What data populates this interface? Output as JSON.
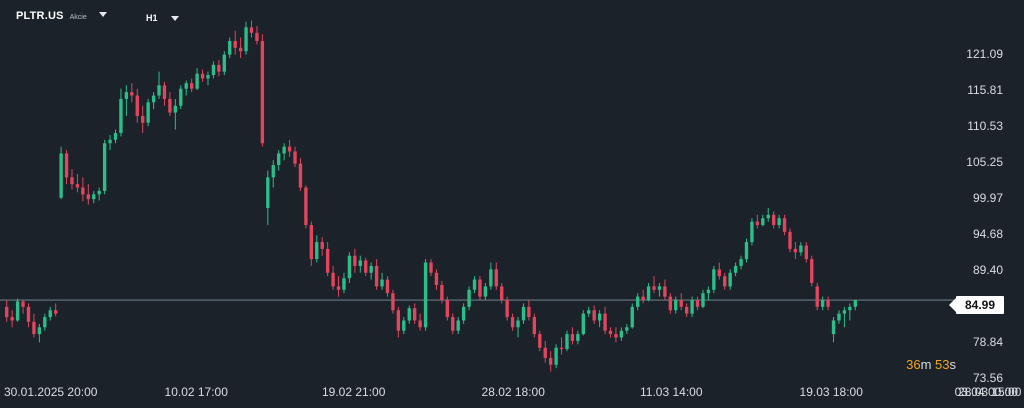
{
  "header": {
    "symbol": "PLTR.US",
    "symbol_type": "Akcie",
    "timeframe": "H1"
  },
  "countdown": {
    "minutes": "36",
    "m": "m",
    "seconds": "53",
    "s": "s"
  },
  "colors": {
    "background": "#1b2229",
    "up": "#2dbd8a",
    "down": "#e2455e",
    "axis_text": "#d9dde1",
    "price_line": "#8aa0ad",
    "countdown": "#f2a51f"
  },
  "chart_data": {
    "type": "candlestick",
    "symbol": "PLTR.US",
    "timeframe": "H1",
    "y_ticks": [
      121.09,
      115.81,
      110.53,
      105.25,
      99.97,
      94.68,
      89.4,
      84.12,
      78.84,
      73.56
    ],
    "y_tick_labels": [
      "121.09",
      "115.81",
      "110.53",
      "105.25",
      "99.97",
      "94.68",
      "89.40",
      "84.12",
      "78.84",
      "73.56"
    ],
    "ylim": [
      73.56,
      126.0
    ],
    "x_tick_labels": [
      "30.01.2025  20:00",
      "10.02  17:00",
      "19.02  21:00",
      "28.02  18:00",
      "11.03  14:00",
      "19.03  18:00",
      "28.03  15:00",
      "03.04  00:00"
    ],
    "x_tick_positions": [
      0,
      0.158,
      0.313,
      0.47,
      0.626,
      0.783,
      0.939,
      1.0
    ],
    "current_price": 84.99,
    "current_price_label": "84.99",
    "grid": false,
    "candles": [
      [
        84.0,
        85.0,
        81.8,
        82.5
      ],
      [
        82.5,
        83.5,
        81.0,
        82.0
      ],
      [
        82.0,
        85.2,
        81.8,
        84.8
      ],
      [
        84.8,
        85.0,
        83.0,
        84.0
      ],
      [
        84.0,
        84.5,
        81.0,
        81.8
      ],
      [
        81.8,
        83.0,
        79.5,
        80.0
      ],
      [
        80.0,
        81.5,
        78.8,
        81.0
      ],
      [
        81.0,
        83.0,
        80.5,
        82.5
      ],
      [
        82.5,
        84.0,
        82.0,
        83.5
      ],
      [
        83.5,
        84.5,
        82.6,
        83.0
      ],
      [
        100.0,
        107.5,
        99.8,
        106.5
      ],
      [
        106.5,
        107.0,
        102.0,
        103.0
      ],
      [
        103.0,
        104.2,
        101.2,
        102.0
      ],
      [
        102.0,
        103.5,
        100.8,
        101.5
      ],
      [
        101.5,
        103.0,
        99.5,
        100.5
      ],
      [
        100.5,
        102.0,
        99.0,
        99.8
      ],
      [
        99.8,
        101.0,
        99.2,
        100.5
      ],
      [
        100.5,
        101.5,
        99.6,
        101.0
      ],
      [
        101.0,
        108.5,
        100.5,
        108.0
      ],
      [
        108.0,
        109.2,
        107.0,
        108.5
      ],
      [
        108.5,
        110.0,
        108.0,
        109.5
      ],
      [
        109.5,
        116.0,
        109.0,
        114.5
      ],
      [
        114.5,
        116.5,
        112.0,
        115.5
      ],
      [
        115.5,
        116.8,
        114.0,
        115.0
      ],
      [
        115.0,
        116.0,
        111.0,
        112.0
      ],
      [
        112.0,
        113.5,
        109.5,
        111.0
      ],
      [
        111.0,
        114.5,
        110.5,
        114.0
      ],
      [
        114.0,
        115.5,
        113.0,
        115.0
      ],
      [
        115.0,
        118.5,
        114.5,
        116.5
      ],
      [
        116.5,
        117.0,
        113.5,
        114.5
      ],
      [
        114.5,
        115.5,
        112.0,
        112.5
      ],
      [
        112.5,
        114.5,
        110.0,
        113.5
      ],
      [
        113.5,
        116.5,
        113.0,
        116.0
      ],
      [
        116.0,
        117.2,
        115.0,
        116.8
      ],
      [
        116.8,
        117.5,
        115.5,
        116.0
      ],
      [
        116.0,
        119.0,
        115.8,
        118.2
      ],
      [
        118.2,
        118.8,
        117.0,
        117.5
      ],
      [
        117.5,
        118.5,
        116.5,
        118.0
      ],
      [
        118.0,
        120.0,
        117.5,
        119.5
      ],
      [
        119.5,
        120.2,
        117.8,
        118.5
      ],
      [
        118.5,
        121.5,
        118.0,
        121.0
      ],
      [
        121.0,
        123.5,
        120.5,
        123.0
      ],
      [
        123.0,
        124.5,
        121.0,
        122.0
      ],
      [
        122.0,
        123.5,
        120.5,
        121.5
      ],
      [
        121.5,
        125.8,
        121.0,
        125.0
      ],
      [
        125.0,
        126.0,
        123.5,
        124.2
      ],
      [
        124.2,
        125.2,
        122.5,
        123.0
      ],
      [
        123.0,
        124.0,
        107.5,
        108.0
      ],
      [
        98.5,
        104.0,
        96.0,
        103.0
      ],
      [
        103.0,
        105.5,
        101.5,
        104.8
      ],
      [
        104.8,
        107.0,
        104.0,
        106.5
      ],
      [
        106.5,
        108.0,
        105.5,
        107.5
      ],
      [
        107.5,
        108.5,
        106.0,
        106.8
      ],
      [
        106.8,
        107.5,
        104.5,
        105.0
      ],
      [
        105.0,
        105.8,
        101.0,
        101.5
      ],
      [
        101.5,
        101.8,
        95.5,
        96.0
      ],
      [
        96.0,
        96.5,
        90.0,
        91.0
      ],
      [
        91.0,
        94.5,
        90.5,
        93.5
      ],
      [
        93.5,
        94.2,
        91.5,
        92.5
      ],
      [
        92.5,
        93.5,
        88.5,
        89.0
      ],
      [
        89.0,
        90.0,
        86.5,
        87.0
      ],
      [
        87.0,
        88.5,
        85.5,
        86.5
      ],
      [
        86.5,
        89.0,
        86.0,
        88.2
      ],
      [
        88.2,
        92.0,
        87.5,
        91.5
      ],
      [
        91.5,
        92.5,
        89.0,
        90.0
      ],
      [
        90.0,
        91.5,
        89.0,
        90.8
      ],
      [
        90.8,
        91.2,
        88.5,
        89.0
      ],
      [
        89.0,
        90.5,
        88.0,
        90.0
      ],
      [
        90.0,
        91.0,
        86.5,
        87.0
      ],
      [
        87.0,
        89.0,
        86.5,
        88.0
      ],
      [
        88.0,
        88.5,
        85.5,
        86.0
      ],
      [
        86.0,
        86.5,
        83.0,
        83.5
      ],
      [
        83.5,
        84.0,
        79.5,
        80.5
      ],
      [
        80.5,
        82.5,
        80.0,
        82.0
      ],
      [
        82.0,
        84.2,
        81.5,
        83.8
      ],
      [
        83.8,
        84.5,
        81.5,
        82.0
      ],
      [
        82.0,
        83.0,
        80.5,
        81.0
      ],
      [
        81.0,
        91.0,
        80.5,
        90.5
      ],
      [
        90.5,
        91.0,
        88.5,
        89.0
      ],
      [
        89.0,
        89.5,
        86.5,
        87.2
      ],
      [
        87.2,
        87.8,
        84.5,
        85.0
      ],
      [
        85.0,
        85.5,
        82.0,
        82.5
      ],
      [
        82.5,
        83.0,
        80.0,
        80.5
      ],
      [
        80.5,
        82.5,
        80.0,
        82.0
      ],
      [
        82.0,
        84.5,
        81.5,
        84.0
      ],
      [
        84.0,
        87.0,
        83.5,
        86.5
      ],
      [
        86.5,
        88.5,
        86.0,
        88.0
      ],
      [
        88.0,
        88.5,
        85.0,
        85.5
      ],
      [
        85.5,
        87.5,
        85.0,
        87.0
      ],
      [
        87.0,
        90.5,
        86.5,
        89.5
      ],
      [
        89.5,
        90.5,
        86.5,
        87.0
      ],
      [
        87.0,
        87.5,
        84.5,
        85.0
      ],
      [
        85.0,
        85.5,
        82.0,
        82.5
      ],
      [
        82.5,
        83.0,
        80.5,
        81.0
      ],
      [
        81.0,
        82.5,
        79.5,
        82.0
      ],
      [
        82.0,
        84.5,
        81.5,
        84.0
      ],
      [
        84.0,
        85.0,
        82.0,
        82.5
      ],
      [
        82.5,
        83.0,
        79.5,
        80.0
      ],
      [
        80.0,
        80.5,
        77.5,
        78.0
      ],
      [
        78.0,
        79.0,
        75.8,
        76.5
      ],
      [
        76.5,
        77.5,
        74.5,
        75.5
      ],
      [
        75.5,
        78.5,
        75.0,
        78.0
      ],
      [
        78.0,
        79.5,
        77.0,
        77.8
      ],
      [
        77.8,
        80.5,
        77.5,
        80.0
      ],
      [
        80.0,
        81.0,
        78.5,
        79.0
      ],
      [
        79.0,
        80.5,
        78.5,
        80.0
      ],
      [
        80.0,
        83.5,
        79.8,
        83.0
      ],
      [
        83.0,
        84.0,
        82.5,
        83.5
      ],
      [
        83.5,
        84.2,
        81.5,
        82.0
      ],
      [
        82.0,
        83.5,
        81.0,
        83.0
      ],
      [
        83.0,
        84.0,
        80.0,
        80.5
      ],
      [
        80.5,
        81.0,
        79.5,
        80.0
      ],
      [
        80.0,
        81.0,
        78.8,
        79.5
      ],
      [
        79.5,
        81.0,
        79.0,
        80.5
      ],
      [
        80.5,
        81.5,
        80.0,
        81.0
      ],
      [
        81.0,
        84.5,
        80.8,
        84.0
      ],
      [
        84.0,
        86.0,
        83.5,
        85.5
      ],
      [
        85.5,
        86.5,
        84.5,
        85.0
      ],
      [
        85.0,
        87.5,
        84.8,
        87.0
      ],
      [
        87.0,
        88.5,
        86.0,
        86.5
      ],
      [
        86.5,
        87.5,
        85.5,
        87.0
      ],
      [
        87.0,
        88.0,
        85.0,
        85.5
      ],
      [
        85.5,
        86.0,
        83.0,
        83.5
      ],
      [
        83.5,
        85.5,
        83.0,
        85.0
      ],
      [
        85.0,
        86.0,
        83.5,
        84.0
      ],
      [
        84.0,
        84.5,
        82.5,
        83.0
      ],
      [
        83.0,
        85.5,
        82.5,
        85.0
      ],
      [
        85.0,
        85.5,
        83.5,
        84.0
      ],
      [
        84.0,
        86.5,
        83.8,
        86.0
      ],
      [
        86.0,
        87.0,
        85.0,
        86.5
      ],
      [
        86.5,
        90.0,
        86.0,
        89.5
      ],
      [
        89.5,
        90.5,
        88.0,
        88.5
      ],
      [
        88.5,
        89.0,
        86.5,
        87.0
      ],
      [
        87.0,
        89.5,
        86.5,
        89.0
      ],
      [
        89.0,
        90.5,
        88.5,
        90.0
      ],
      [
        90.0,
        91.5,
        89.5,
        91.0
      ],
      [
        91.0,
        94.0,
        90.5,
        93.5
      ],
      [
        93.5,
        97.0,
        93.0,
        96.5
      ],
      [
        96.5,
        97.5,
        95.5,
        96.0
      ],
      [
        96.0,
        97.5,
        95.8,
        97.0
      ],
      [
        97.0,
        98.5,
        96.5,
        97.5
      ],
      [
        97.5,
        98.0,
        95.5,
        96.0
      ],
      [
        96.0,
        97.5,
        95.5,
        97.0
      ],
      [
        97.0,
        97.5,
        94.5,
        95.0
      ],
      [
        95.0,
        95.5,
        92.0,
        92.5
      ],
      [
        92.5,
        93.5,
        91.0,
        92.0
      ],
      [
        92.0,
        93.5,
        91.5,
        93.0
      ],
      [
        93.0,
        93.5,
        90.5,
        91.0
      ],
      [
        91.0,
        91.5,
        87.0,
        87.5
      ],
      [
        87.0,
        87.5,
        83.5,
        84.0
      ],
      [
        84.0,
        85.5,
        83.5,
        85.0
      ],
      [
        85.0,
        85.5,
        83.5,
        84.0
      ],
      [
        80.0,
        82.5,
        78.8,
        82.0
      ],
      [
        82.0,
        83.5,
        81.5,
        83.0
      ],
      [
        83.0,
        84.0,
        81.0,
        83.5
      ],
      [
        83.5,
        84.5,
        82.0,
        84.0
      ],
      [
        84.0,
        85.0,
        83.5,
        84.99
      ]
    ]
  }
}
